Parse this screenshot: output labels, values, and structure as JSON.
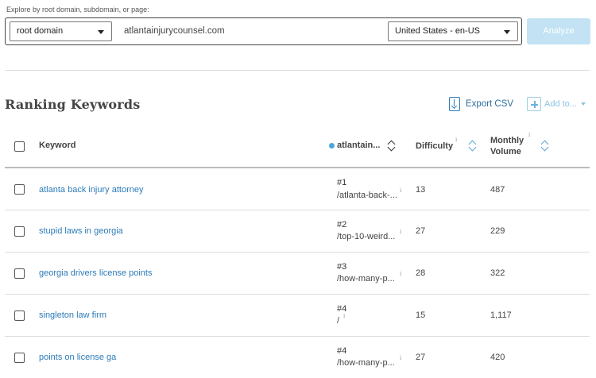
{
  "search": {
    "label": "Explore by root domain, subdomain, or page:",
    "scope": "root domain",
    "domain": "atlantainjurycounsel.com",
    "locale": "United States - en-US",
    "analyze_label": "Analyze"
  },
  "section": {
    "title": "Ranking Keywords",
    "export_label": "Export CSV",
    "add_to_label": "Add to..."
  },
  "columns": {
    "keyword": "Keyword",
    "site": "atlantain...",
    "difficulty": "Difficulty",
    "monthly_volume_line1": "Monthly",
    "monthly_volume_line2": "Volume",
    "info_glyph": "i"
  },
  "rows": [
    {
      "keyword": "atlanta back injury attorney",
      "rank": "#1",
      "url": "/atlanta-back-...",
      "difficulty": "13",
      "volume": "487"
    },
    {
      "keyword": "stupid laws in georgia",
      "rank": "#2",
      "url": "/top-10-weird...",
      "difficulty": "27",
      "volume": "229"
    },
    {
      "keyword": "georgia drivers license points",
      "rank": "#3",
      "url": "/how-many-p...",
      "difficulty": "28",
      "volume": "322"
    },
    {
      "keyword": "singleton law firm",
      "rank": "#4",
      "url": "/",
      "difficulty": "15",
      "volume": "1,117"
    },
    {
      "keyword": "points on license ga",
      "rank": "#4",
      "url": "/how-many-p...",
      "difficulty": "27",
      "volume": "420"
    }
  ],
  "colors": {
    "accent": "#2b7bb9",
    "analyze_disabled": "#c3e3f4",
    "site_dot": "#4aa6dc",
    "sort_blue": "#5ba6d6"
  },
  "icons": {
    "scope_caret": "caret-down-icon",
    "locale_caret": "caret-down-icon",
    "export": "export-csv-icon",
    "add": "plus-icon",
    "sort": "sort-icon",
    "info": "info-icon"
  }
}
